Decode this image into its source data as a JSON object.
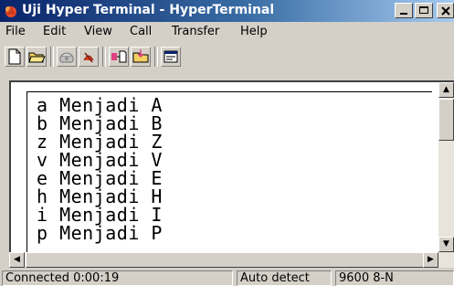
{
  "window": {
    "title": "Uji Hyper Terminal - HyperTerminal"
  },
  "menu": [
    "File",
    "Edit",
    "View",
    "Call",
    "Transfer",
    "Help"
  ],
  "toolbar": [
    {
      "name": "new-connection",
      "icon": "new-document-icon"
    },
    {
      "name": "open",
      "icon": "open-folder-icon"
    },
    {
      "name": "connect",
      "icon": "phone-icon"
    },
    {
      "name": "disconnect",
      "icon": "hangup-icon"
    },
    {
      "name": "send",
      "icon": "send-file-icon"
    },
    {
      "name": "receive",
      "icon": "receive-file-icon"
    },
    {
      "name": "properties",
      "icon": "properties-icon"
    }
  ],
  "terminal": {
    "lines": [
      "a Menjadi A",
      "b Menjadi B",
      "z Menjadi Z",
      "v Menjadi V",
      "e Menjadi E",
      "h Menjadi H",
      "i Menjadi I",
      "p Menjadi P"
    ]
  },
  "status": {
    "connected": "Connected 0:00:19",
    "detect": "Auto detect",
    "port": "9600 8-N"
  },
  "colors": {
    "title_start": "#0a246a",
    "title_end": "#a6caf0",
    "chrome": "#d4d0c8"
  }
}
